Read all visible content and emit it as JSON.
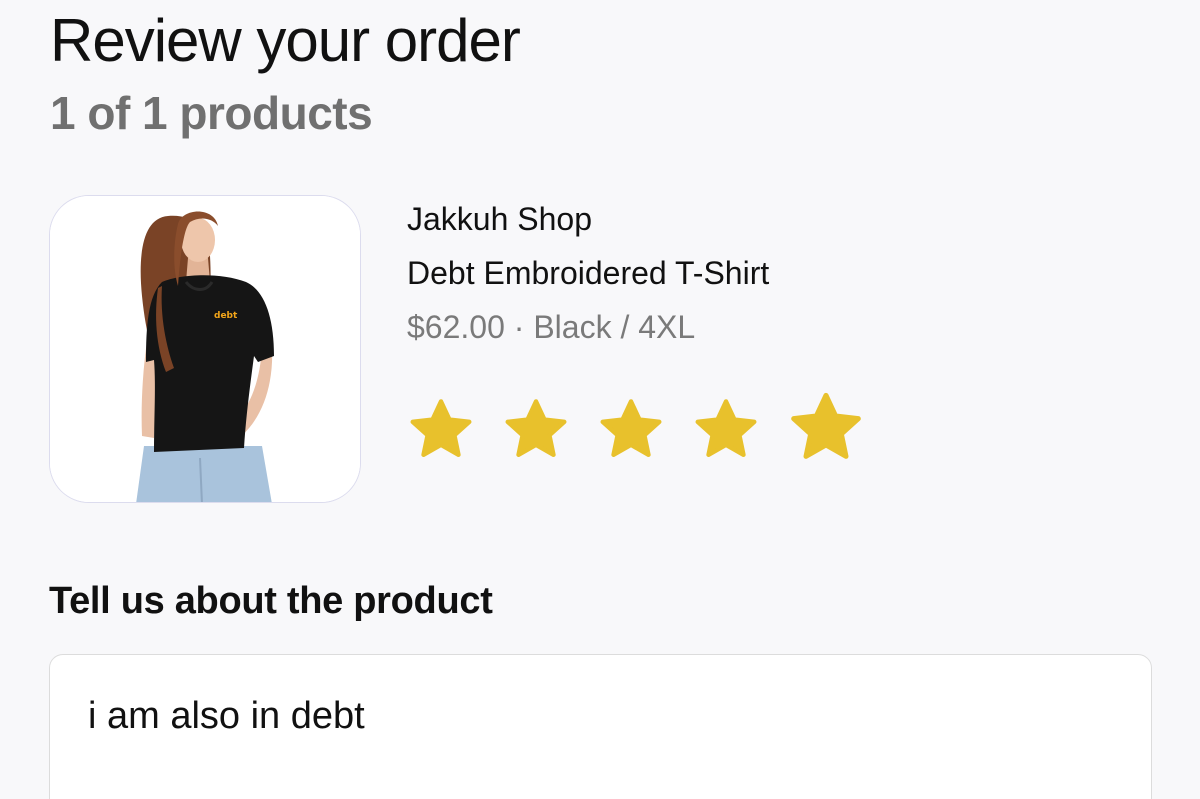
{
  "header": {
    "title": "Review your order",
    "subtitle": "1 of 1 products"
  },
  "product": {
    "shop_name": "Jakkuh Shop",
    "name": "Debt Embroidered T-Shirt",
    "price": "$62.00",
    "separator": "·",
    "variant": "Black / 4XL",
    "meta": "$62.00 · Black / 4XL",
    "shirt_embroidery": "debt",
    "image_icon": "product-photo-woman-black-tshirt"
  },
  "rating": {
    "value": 5,
    "max": 5,
    "star_color": "#e8c12c"
  },
  "review": {
    "label": "Tell us about the product",
    "text": "i am also in debt"
  },
  "colors": {
    "background": "#f8f8fa",
    "subtitle": "#707070",
    "meta": "#7a7a7a",
    "star": "#e8c12c"
  }
}
